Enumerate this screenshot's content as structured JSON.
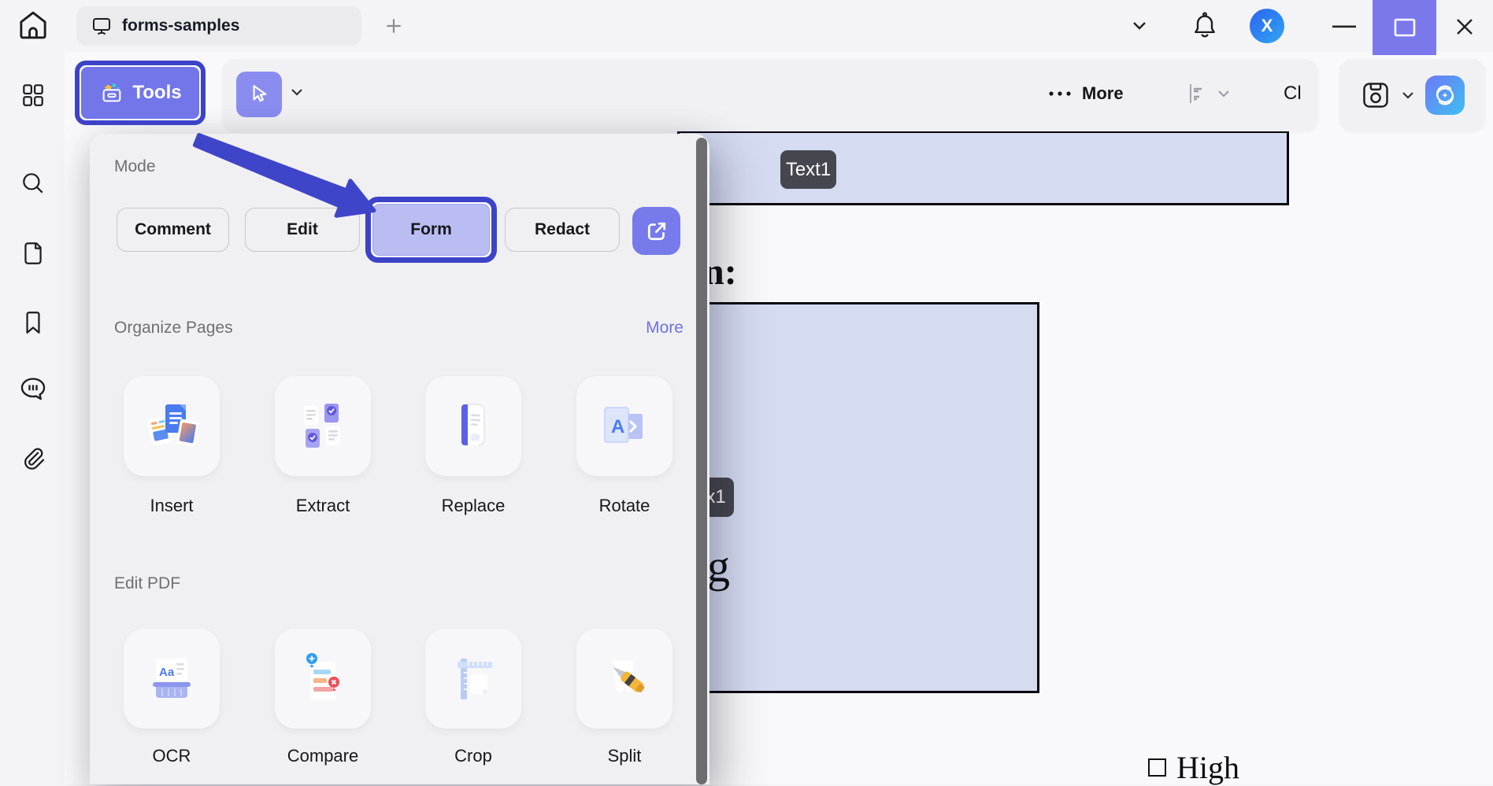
{
  "topbar": {
    "tab_title": "forms-samples",
    "avatar_initial": "X"
  },
  "toolbar": {
    "tools_label": "Tools",
    "more_label": "More",
    "clipped_label": "Cl"
  },
  "panel": {
    "mode": {
      "label": "Mode",
      "comment": "Comment",
      "edit": "Edit",
      "form": "Form",
      "redact": "Redact"
    },
    "organize": {
      "title": "Organize Pages",
      "more_link": "More",
      "items": [
        {
          "label": "Insert"
        },
        {
          "label": "Extract"
        },
        {
          "label": "Replace"
        },
        {
          "label": "Rotate"
        }
      ]
    },
    "editpdf": {
      "title": "Edit PDF",
      "items": [
        {
          "label": "OCR"
        },
        {
          "label": "Compare"
        },
        {
          "label": "Crop"
        },
        {
          "label": "Split"
        }
      ]
    }
  },
  "document": {
    "field1_tag": "Text1",
    "heading_fragment": "n:",
    "field2_tag_fragment": "x1",
    "letter_fragment": "g",
    "checkbox_label": "High"
  },
  "colors": {
    "accent_indigo": "#3d43c8",
    "accent_purple": "#7276e8",
    "field_blue": "#d5dbf1",
    "more_link": "#6f72e0"
  }
}
